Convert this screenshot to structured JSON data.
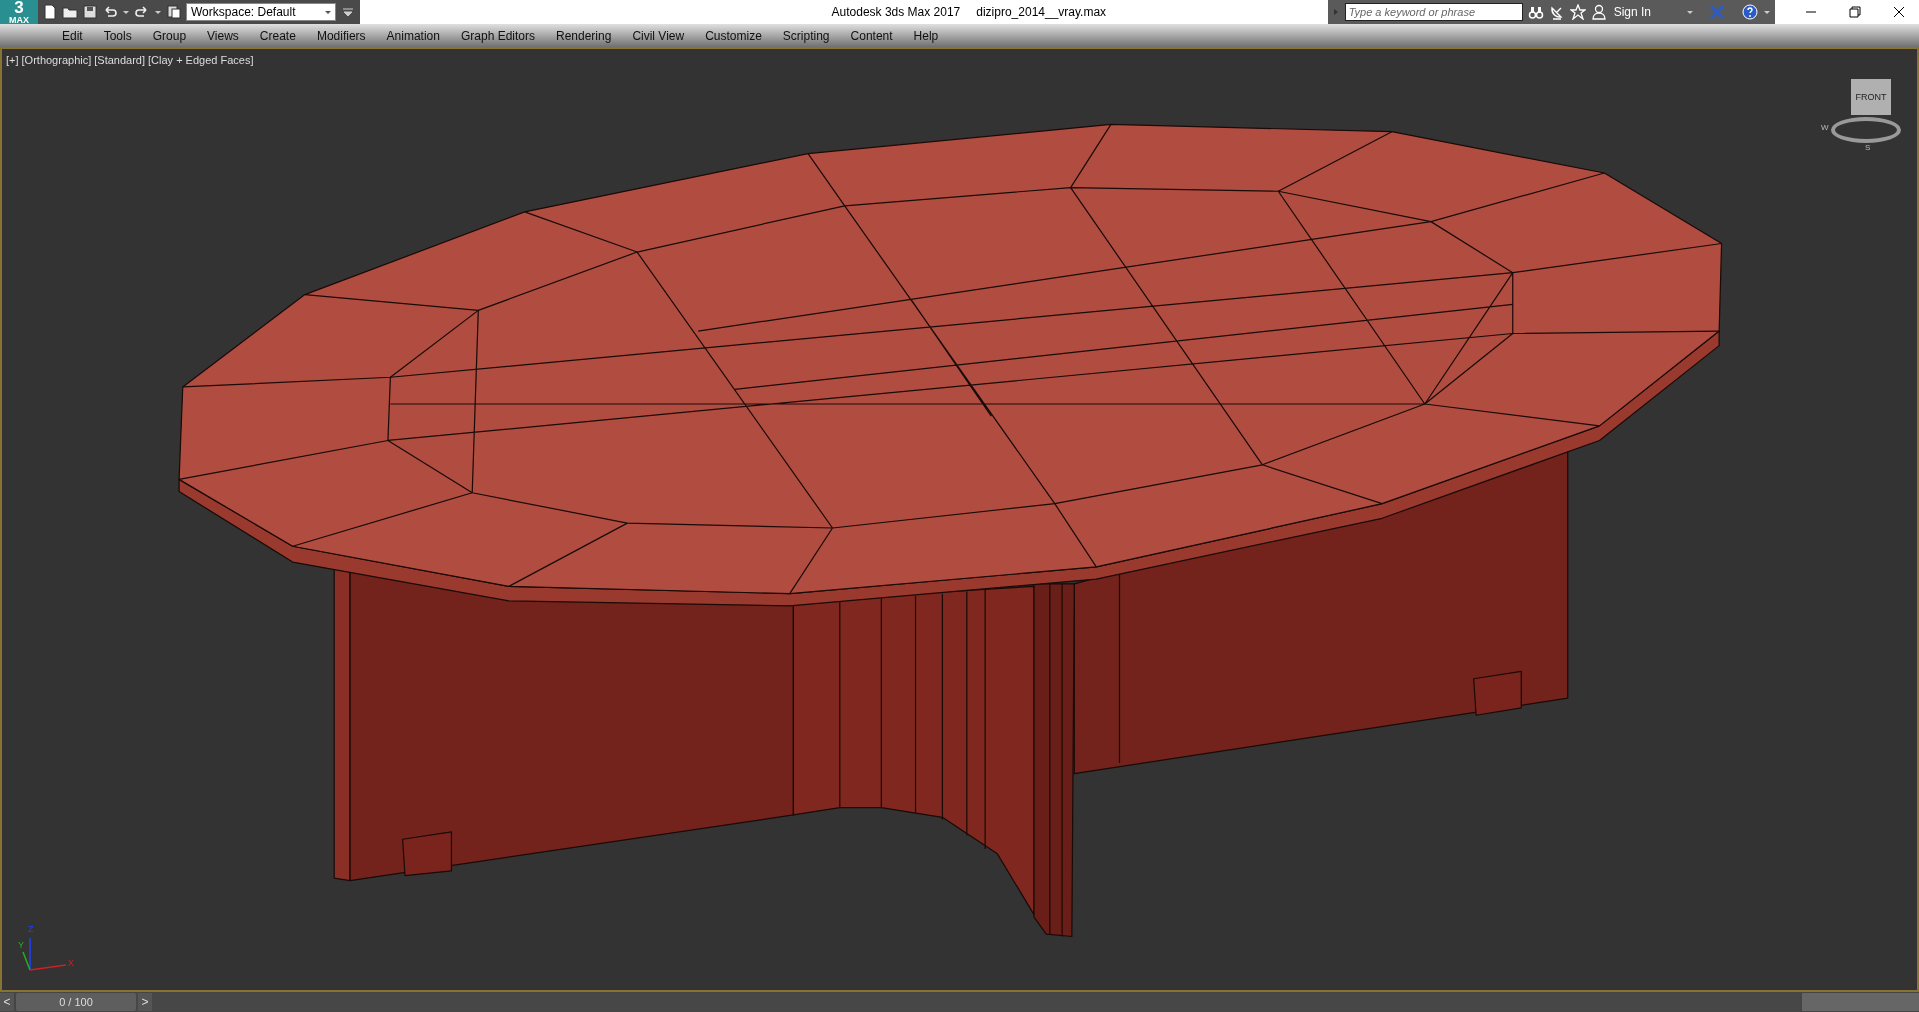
{
  "logo": {
    "mark": "3",
    "sub": "MAX"
  },
  "workspace": "Workspace: Default",
  "window": {
    "title": "Autodesk 3ds Max 2017",
    "file": "dizipro_2014__vray.max"
  },
  "search": {
    "placeholder": "Type a keyword or phrase"
  },
  "sign_in": "Sign In",
  "menu": [
    "Edit",
    "Tools",
    "Group",
    "Views",
    "Create",
    "Modifiers",
    "Animation",
    "Graph Editors",
    "Rendering",
    "Civil View",
    "Customize",
    "Scripting",
    "Content",
    "Help"
  ],
  "viewport": {
    "labels": [
      "[+]",
      "[Orthographic]",
      "[Standard]",
      "[Clay + Edged Faces]"
    ],
    "view_cube": {
      "face": "FRONT",
      "compass": [
        "W",
        "S"
      ]
    },
    "axes": [
      "Z",
      "Y",
      "X"
    ]
  },
  "time_slider": {
    "prev": "<",
    "frame": "0 / 100",
    "level": 0,
    "next": ">"
  }
}
